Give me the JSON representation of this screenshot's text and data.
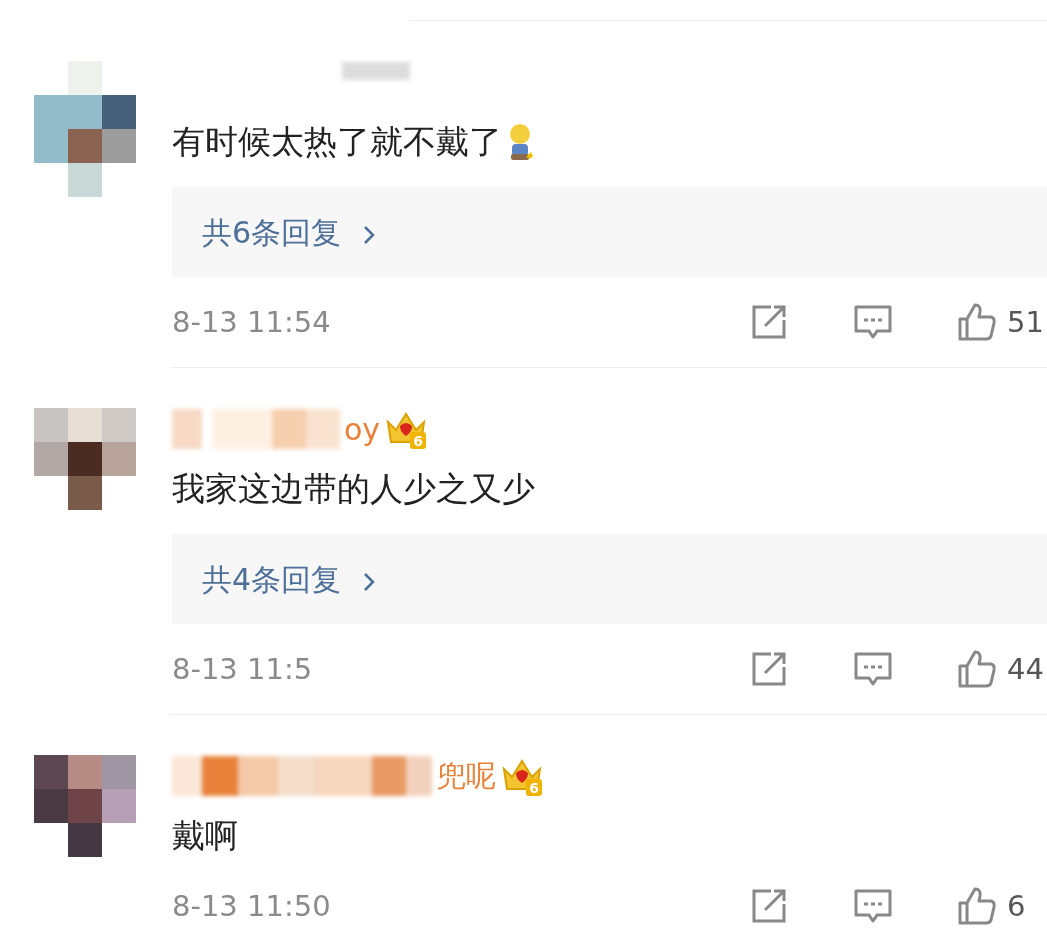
{
  "comments": [
    {
      "text": "有时候太热了就不戴了",
      "emoji": true,
      "replies": "共6条回复",
      "time": "8-13 11:54",
      "likes": "51"
    },
    {
      "name_fragment": "oy",
      "badge": "6",
      "text": "我家这边带的人少之又少",
      "emoji": false,
      "replies": "共4条回复",
      "time": "8-13 11:5",
      "likes": "44"
    },
    {
      "name_fragment": "兜呢",
      "badge": "6",
      "text": "戴啊",
      "emoji": false,
      "time": "8-13 11:50",
      "likes": "6"
    }
  ]
}
